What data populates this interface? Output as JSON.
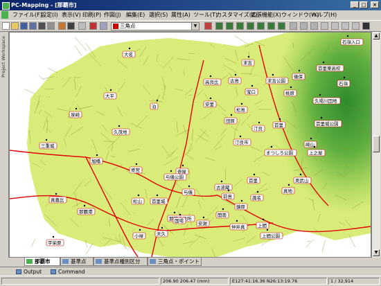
{
  "window": {
    "title": "PC-Mapping - [那覇市]",
    "min": "_",
    "max": "□",
    "close": "×"
  },
  "menu": {
    "items": [
      "ファイル(F)",
      "設定(I)",
      "表示(V)",
      "印刷(P)",
      "作図(J)",
      "編集(E)",
      "選択(S)",
      "属性(A)",
      "ツール(T)",
      "カスタマイズ(Z)",
      "拡張機能(X)",
      "ウィンドウ(W)",
      "ヘルプ(H)"
    ]
  },
  "toolbar": {
    "layer_select": "三角点"
  },
  "sidepanel": {
    "label": "Project Workspace"
  },
  "map": {
    "labels": [
      "石嶺入口",
      "末吉",
      "首里東高校",
      "大名",
      "儀保",
      "石嶺",
      "古島",
      "末吉公園",
      "高良比",
      "宝口",
      "桃原",
      "大平",
      "安里",
      "松島",
      "久場川団地",
      "首里城公園",
      "汀良",
      "泊",
      "首里",
      "崎山",
      "三重城",
      "久茂地",
      "汀良市",
      "泉崎",
      "まつしろ公園",
      "上之屋",
      "旭橋",
      "壺屋",
      "首里",
      "奥武山",
      "与儀公園",
      "寄宮",
      "真地",
      "古波蔵",
      "与儀",
      "首里城",
      "開南",
      "那覇市役所",
      "天久",
      "前島",
      "那覇港",
      "松山",
      "国場",
      "安謝",
      "識名",
      "宇栄原",
      "仲井真",
      "上間",
      "上間公園",
      "鏡原",
      "田原",
      "真嘉比",
      "小禄"
    ]
  },
  "tabs": {
    "items": [
      "那覇市",
      "基準点",
      "基準点種別区分",
      "三角点・ポイント"
    ]
  },
  "bottomtabs": {
    "output": "Output",
    "command": "Command"
  },
  "status": {
    "coord": "206.90 206.47 (mm)",
    "latlon": "E127:41:16.36 N26:13:19.76",
    "zoom": "1 / 32,914"
  },
  "colors": {
    "map_bg": "#ffffff",
    "urban": "#d9ec7a",
    "hill_dark": "#2e8b2e",
    "road": "#e00000",
    "title_bar": "#0a246a"
  }
}
